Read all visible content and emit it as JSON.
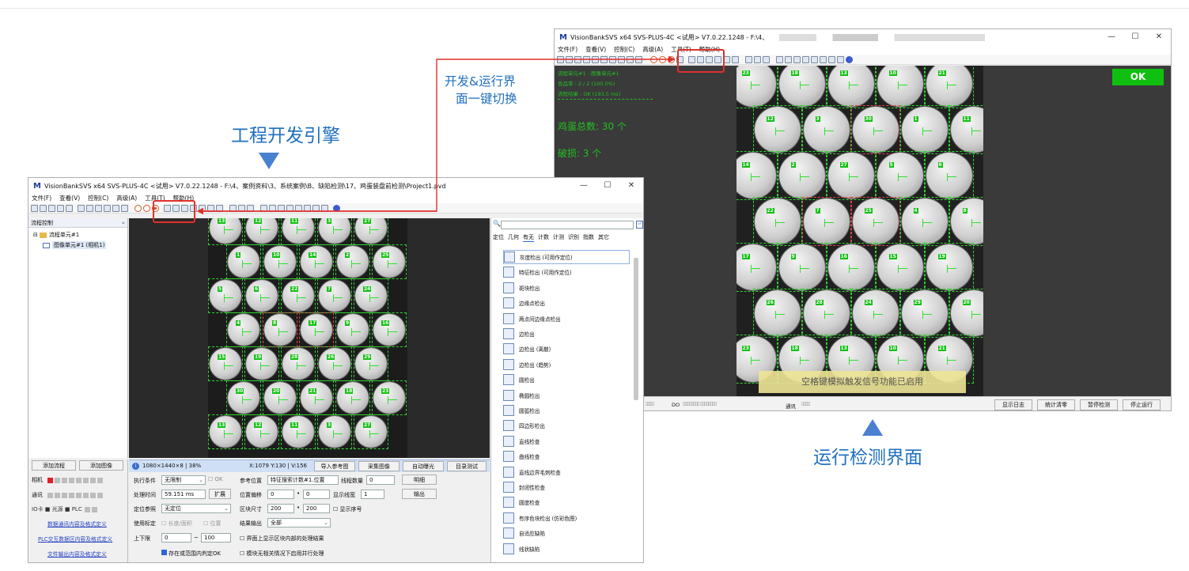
{
  "annotations": {
    "dev_engine": "工程开发引擎",
    "switch_line1": "开发&运行界",
    "switch_line2": "面一键切换",
    "run_ui": "运行检测界面"
  },
  "colors": {
    "accent_blue": "#1f6fc0",
    "highlight_red": "#e0302a",
    "ok_green": "#10c010"
  },
  "dev_window": {
    "title": "VisionBankSVS x64 SVS-PLUS-4C <试用> V7.0.22.1248 - F:\\4、案例资料\\3、系统案例\\B、缺陷检测\\17、鸡蛋装盘前检测\\Project1.pvd",
    "controls": [
      "—",
      "☐",
      "✕"
    ],
    "menu": [
      "文件(F)",
      "查看(V)",
      "控制(C)",
      "高级(A)",
      "工具(T)",
      "帮助(H)"
    ],
    "flow_header": "流程控制",
    "tree_root": "流程单元#1",
    "tree_child": "图像单元#1 (相机1)",
    "btn_add_flow": "添加流程",
    "btn_add_image": "添加图像",
    "status_rows": [
      {
        "label": "相机"
      },
      {
        "label": "通讯"
      },
      {
        "label": "IO卡 ■ 光源 ■ PLC"
      }
    ],
    "links": [
      "数据通讯内容及格式定义",
      "PLC交互数据区内容及格式定义",
      "文件输出内容及格式定义"
    ],
    "image_status": {
      "info": "1080×1440×8 | 38%",
      "coords": "X:1079 Y:130 | V:156",
      "btn_import": "导入参考图",
      "btn_capture": "采集图像",
      "btn_exposure": "自动曝光",
      "btn_dir_test": "目录测试"
    },
    "params": {
      "exec_cond_label": "执行条件",
      "exec_cond_value": "无限制",
      "ok_label": "OK",
      "proc_time_label": "处理时间",
      "proc_time_value": "59.151 ms",
      "expand_btn": "扩展",
      "locate_ref_label": "定位参照",
      "locate_ref_value": "无定位",
      "calib_label": "使用标定",
      "calib_opt1": "长度/面积",
      "calib_opt2": "位置",
      "limit_label": "上下限",
      "limit_low": "0",
      "limit_tilde": "~",
      "limit_high": "100",
      "exist_judge": "存在或范围内判定OK",
      "ref_pos_label": "参考位置",
      "ref_pos_value": "特征搜索计数#1.位置",
      "thread_label": "线程数量",
      "thread_value": "0",
      "detail_btn": "明细",
      "offset_label": "位置偏移",
      "offset_x": "0",
      "offset_y": "0",
      "line_width_label": "显示线宽",
      "line_width_value": "1",
      "output_btn": "输出",
      "block_size_label": "区块尺寸",
      "block_w": "200",
      "block_h": "200",
      "show_seq": "显示序号",
      "result_out_label": "结果输出",
      "result_out_value": "全部",
      "ui_show_result": "界面上显示区块内部的处理结果",
      "parallel": "模块无相关情况下启用并行处理"
    },
    "tool_tabs": [
      "定位",
      "几何",
      "有无",
      "计数",
      "计测",
      "识别",
      "指数",
      "其它"
    ],
    "tools": [
      "灰度检出 (可用作定位)",
      "特征检出 (可用作定位)",
      "斑块检出",
      "边缘点检出",
      "两点间边缘点检出",
      "边检出",
      "边检出 (离散)",
      "边检出 (趋势)",
      "圆检出",
      "椭圆检出",
      "圆弧检出",
      "四边形检出",
      "直线检查",
      "曲线检查",
      "直线边界毛刺检查",
      "封闭性检查",
      "圆度检查",
      "有序色块检出 (仿彩色图)",
      "自适应缺陷",
      "线状缺陷"
    ]
  },
  "run_window": {
    "title": "VisionBankSVS x64 SVS-PLUS-4C <试用> V7.0.22.1248 - F:\\4、",
    "controls": [
      "—",
      "☐",
      "✕"
    ],
    "menu": [
      "文件(F)",
      "查看(V)",
      "控制(C)",
      "高级(A)",
      "工具(T)",
      "帮助(H)"
    ],
    "overlay_lines": [
      "流程单元#1 - 图像单元#1",
      "良品率 : 2 / 2 (100.0%)",
      "流程结果 : OK (193.5 ms)"
    ],
    "egg_total": "鸡蛋总数: 30 个",
    "broken": "破损: 3 个",
    "ok_badge": "OK",
    "trigger_banner": "空格键模拟触发信号功能已启用",
    "do_label": "DO",
    "comm_label": "通讯",
    "buttons": [
      "显示日志",
      "统计清零",
      "暂停检测",
      "停止运行"
    ]
  }
}
